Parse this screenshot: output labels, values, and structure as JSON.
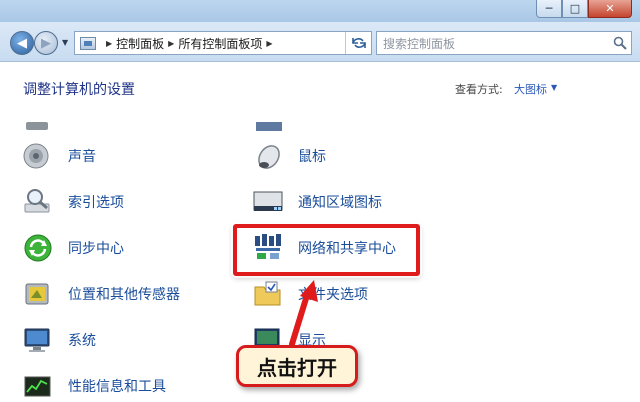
{
  "window": {
    "minimize_glyph": "─",
    "maximize_glyph": "□",
    "close_glyph": "✕"
  },
  "nav": {
    "back_glyph": "◀",
    "forward_glyph": "▶",
    "breadcrumbs": [
      "控制面板",
      "所有控制面板项"
    ],
    "search_placeholder": "搜索控制面板"
  },
  "main": {
    "heading": "调整计算机的设置",
    "view_by_label": "查看方式:",
    "view_by_value": "大图标"
  },
  "items_left": [
    {
      "label": "声音",
      "icon": "speaker-icon"
    },
    {
      "label": "索引选项",
      "icon": "magnifier-icon"
    },
    {
      "label": "同步中心",
      "icon": "sync-icon"
    },
    {
      "label": "位置和其他传感器",
      "icon": "sensor-icon"
    },
    {
      "label": "系统",
      "icon": "computer-icon"
    },
    {
      "label": "性能信息和工具",
      "icon": "performance-icon"
    }
  ],
  "items_right": [
    {
      "label": "鼠标",
      "icon": "mouse-icon"
    },
    {
      "label": "通知区域图标",
      "icon": "taskbar-icon"
    },
    {
      "label": "网络和共享中心",
      "icon": "network-icon"
    },
    {
      "label": "文件夹选项",
      "icon": "folder-icon"
    },
    {
      "label": "显示",
      "icon": "display-icon"
    }
  ],
  "annotation": {
    "callout_text": "点击打开"
  },
  "colors": {
    "link_blue": "#1a4d9a",
    "heading_blue": "#1e3287",
    "highlight_red": "#e01b1b",
    "callout_bg": "#fff3d8"
  }
}
